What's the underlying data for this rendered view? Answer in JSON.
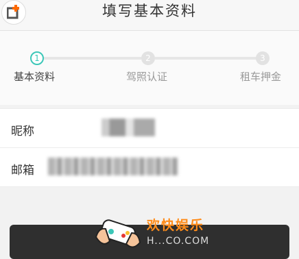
{
  "header": {
    "title": "填写基本资料"
  },
  "steps": [
    {
      "number": "1",
      "label": "基本资料",
      "active": true
    },
    {
      "number": "2",
      "label": "驾照认证",
      "active": false
    },
    {
      "number": "3",
      "label": "租车押金",
      "active": false
    }
  ],
  "form": {
    "nickname_label": "昵称",
    "email_label": "邮箱"
  },
  "watermark": {
    "text": "欢快娱乐",
    "sub": "H...CO.COM"
  },
  "colors": {
    "accent": "#3cc7b8",
    "brand": "#ff8c1a",
    "button": "#2f2f2f"
  }
}
